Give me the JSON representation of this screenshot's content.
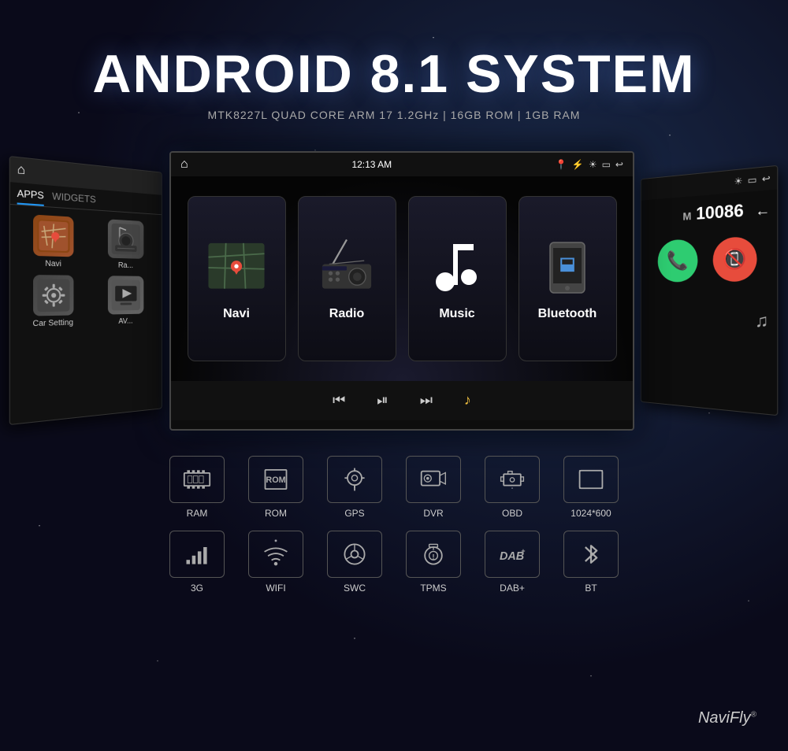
{
  "header": {
    "title": "ANDROID 8.1 SYSTEM",
    "specs": "MTK8227L QUAD CORE ARM 17 1.2GHz | 16GB ROM | 1GB RAM"
  },
  "left_screen": {
    "tabs": [
      "APPS",
      "WIDGETS"
    ],
    "active_tab": "APPS",
    "apps": [
      {
        "name": "Navi",
        "icon": "🗺"
      },
      {
        "name": "Ra...",
        "icon": "📻"
      },
      {
        "name": "Car Setting",
        "icon": "⚙"
      },
      {
        "name": "AV...",
        "icon": "🎬"
      }
    ]
  },
  "center_screen": {
    "statusbar": {
      "time": "12:13 AM",
      "icons": [
        "📍",
        "🔵",
        "☀",
        "🔋",
        "↩"
      ]
    },
    "apps": [
      {
        "id": "navi",
        "label": "Navi"
      },
      {
        "id": "radio",
        "label": "Radio"
      },
      {
        "id": "music",
        "label": "Music"
      },
      {
        "id": "bluetooth",
        "label": "Bluetooth"
      }
    ],
    "controls": [
      "⏮",
      "⏯",
      "⏭",
      "🎵"
    ]
  },
  "right_screen": {
    "phone_number": "10086",
    "buttons": [
      "answer",
      "decline"
    ]
  },
  "features_row1": [
    {
      "id": "ram",
      "label": "RAM"
    },
    {
      "id": "rom",
      "label": "ROM"
    },
    {
      "id": "gps",
      "label": "GPS"
    },
    {
      "id": "dvr",
      "label": "DVR"
    },
    {
      "id": "obd",
      "label": "OBD"
    },
    {
      "id": "resolution",
      "label": "1024*600"
    }
  ],
  "features_row2": [
    {
      "id": "3g",
      "label": "3G"
    },
    {
      "id": "wifi",
      "label": "WIFI"
    },
    {
      "id": "swc",
      "label": "SWC"
    },
    {
      "id": "tpms",
      "label": "TPMS"
    },
    {
      "id": "dab",
      "label": "DAB+"
    },
    {
      "id": "bt",
      "label": "BT"
    }
  ],
  "brand": {
    "name": "NaviFly",
    "trademark": "®"
  }
}
